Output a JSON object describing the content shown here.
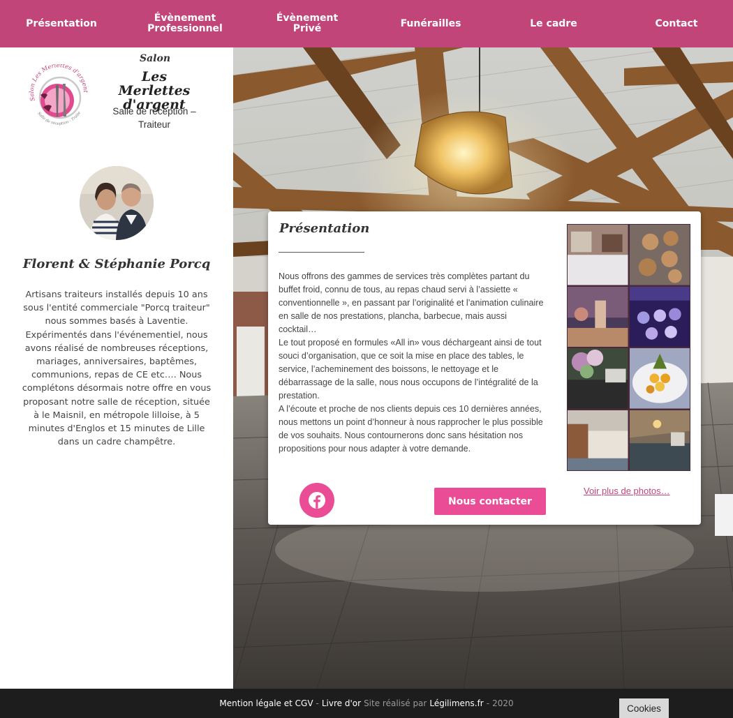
{
  "nav": {
    "items": [
      {
        "label_line1": "Présentation",
        "label_line2": ""
      },
      {
        "label_line1": "Évènement",
        "label_line2": "Professionnel"
      },
      {
        "label_line1": "Évènement",
        "label_line2": "Privé"
      },
      {
        "label_line1": "Funérailles",
        "label_line2": ""
      },
      {
        "label_line1": "Le cadre",
        "label_line2": ""
      },
      {
        "label_line1": "Contact",
        "label_line2": ""
      }
    ]
  },
  "brand": {
    "salon_word": "Salon",
    "name_line1": "Les Merlettes",
    "name_line2": "d'argent",
    "subtitle_line1": "Salle de réception –",
    "subtitle_line2": "Traiteur",
    "logo_text": "Salon Les Merlettes d'argent",
    "logo_subtext": "Salle de réception - Traiteur"
  },
  "owners": {
    "name": "Florent & Stéphanie Porcq",
    "bio": "Artisans traiteurs installés depuis 10 ans sous l'entité commerciale \"Porcq traiteur\" nous sommes basés à Laventie. Expérimentés dans l'événementiel, nous avons réalisé de nombreuses réceptions, mariages, anniversaires, baptêmes, communions, repas de CE etc…. Nous complétons désormais notre offre en vous proposant notre salle de réception, située à le Maisnil, en métropole lilloise, à 5 minutes d'Englos et 15 minutes de Lille dans un cadre champêtre."
  },
  "card": {
    "title": "Présentation",
    "paragraph1": "Nous offrons des gammes de services très complètes partant du buffet froid, connu de tous, au repas chaud servi à l’assiette « conventionnelle », en passant par  l’originalité et l’animation culinaire en salle de nos prestations, plancha, barbecue, mais aussi cocktail…",
    "paragraph2": "Le tout proposé en formules «All in» vous déchargeant ainsi de tout souci d’organisation, que ce soit la mise en place des tables, le service, l’acheminement des boissons, le nettoyage et le débarrassage de la salle,  nous nous occupons de l’intégralité de la prestation.",
    "paragraph3": "A l’écoute et proche de nos clients depuis ces 10 dernières années, nous mettons un point d’honneur à nous rapprocher le plus possible de vos souhaits. Nous contournerons donc sans hésitation nos propositions pour nous adapter à votre demande.",
    "contact_button": "Nous contacter",
    "more_photos": "Voir plus de photos…",
    "facebook_icon": "facebook-icon"
  },
  "footer": {
    "legal": "Mention légale et CGV",
    "sep": "-",
    "guestbook": "Livre d'or",
    "made_by_prefix": "Site réalisé par",
    "agency": "Légilimens.fr",
    "year_sep": "-",
    "year": "2020",
    "cookies": "Cookies"
  },
  "colors": {
    "brand_pink": "#c2457a",
    "button_pink": "#ea4c95",
    "footer_bg": "#1d1d1d"
  }
}
